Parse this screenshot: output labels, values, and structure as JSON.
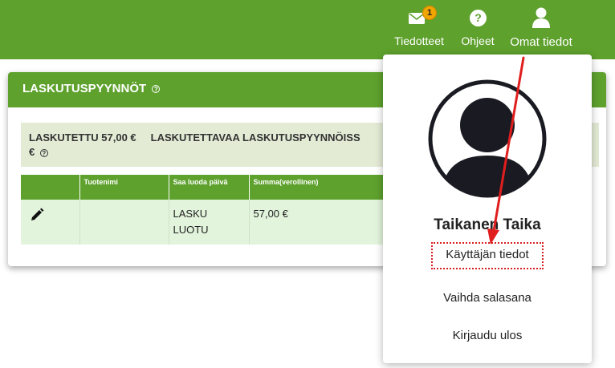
{
  "topbar": {
    "news_label": "Tiedotteet",
    "news_badge": "1",
    "help_label": "Ohjeet",
    "profile_label": "Omat tiedot",
    "brand_color": "#5ea12d"
  },
  "panel": {
    "title": "LASKUTUSPYYNNÖT",
    "help_icon": "question-circle-icon",
    "summary_billed": "LASKUTETTU 57,00 €",
    "summary_pending": "LASKUTETTAVAA LASKUTUSPYYNNÖISS",
    "summary_pending_cont": "€"
  },
  "table": {
    "headers": [
      "",
      "Tuotenimi",
      "Saa luoda päivä",
      "Summa(verollinen)"
    ],
    "rows": [
      {
        "edit_icon": "pencil-icon",
        "product": "",
        "create_date": "LASKU LUOTU",
        "amount": "57,00 €"
      }
    ]
  },
  "dropdown": {
    "user_name": "Taikanen Taika",
    "user_details": "Käyttäjän tiedot",
    "change_password": "Vaihda salasana",
    "logout": "Kirjaudu ulos",
    "highlight_color": "#d81e1e"
  }
}
